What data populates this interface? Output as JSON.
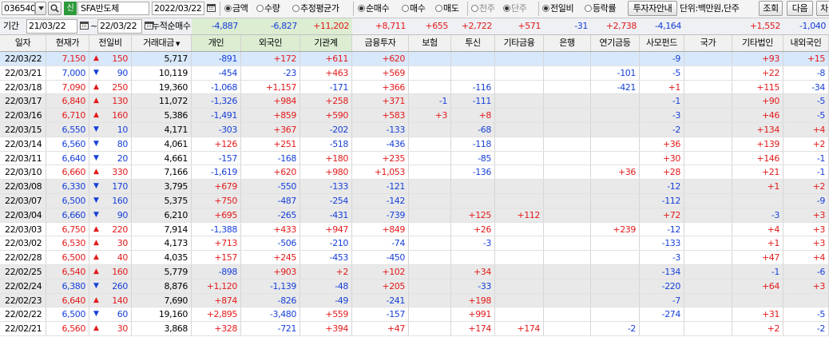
{
  "toolbar": {
    "code": "036540",
    "search_icon": "magnifier-icon",
    "badge": "신",
    "name": "SFA반도체",
    "date": "2022/03/22",
    "radio_group1": [
      {
        "label": "금액",
        "checked": true,
        "dim": false
      },
      {
        "label": "수량",
        "checked": false,
        "dim": false
      },
      {
        "label": "추정평균가",
        "checked": false,
        "dim": false
      }
    ],
    "radio_group2": [
      {
        "label": "순매수",
        "checked": true,
        "dim": false
      },
      {
        "label": "매수",
        "checked": false,
        "dim": false
      },
      {
        "label": "매도",
        "checked": false,
        "dim": false
      }
    ],
    "radio_group3": [
      {
        "label": "천주",
        "checked": false,
        "dim": true
      },
      {
        "label": "단주",
        "checked": true,
        "dim": true
      }
    ],
    "radio_group4": [
      {
        "label": "전일비",
        "checked": true,
        "dim": false
      },
      {
        "label": "등락률",
        "checked": false,
        "dim": false
      }
    ],
    "guide_button": "투자자안내",
    "unit_label": "단위:백만원,단주",
    "search_button": "조회",
    "next_button": "다음",
    "chart_button": "차"
  },
  "period": {
    "label": "기간",
    "from": "21/03/22",
    "tilde": "~",
    "to": "22/03/22",
    "cum_label": "누적순매수",
    "cum_values": [
      "-4,887",
      "-6,827",
      "+11,202",
      "+8,711",
      "+655",
      "+2,722",
      "+571",
      "-31",
      "+2,738",
      "-4,164",
      "",
      "+1,552",
      "-1,040"
    ]
  },
  "columns": [
    "일자",
    "현재가",
    "전일비",
    "거래대금",
    "개인",
    "외국인",
    "기관계",
    "금융투자",
    "보험",
    "투신",
    "기타금융",
    "은행",
    "연기금등",
    "사모펀드",
    "국가",
    "기타법인",
    "내외국인"
  ],
  "rows": [
    {
      "date": "22/03/22",
      "price": "7,150",
      "dir": "up",
      "chg": "150",
      "vol": "5,717",
      "vals": [
        "-891",
        "+172",
        "+611",
        "+620",
        "",
        "",
        "",
        "",
        "",
        "-9",
        "",
        "+93",
        "+15"
      ]
    },
    {
      "date": "22/03/21",
      "price": "7,000",
      "dir": "down",
      "chg": "90",
      "vol": "10,119",
      "vals": [
        "-454",
        "-23",
        "+463",
        "+569",
        "",
        "",
        "",
        "",
        "-101",
        "-5",
        "",
        "+22",
        "-8"
      ]
    },
    {
      "date": "22/03/18",
      "price": "7,090",
      "dir": "up",
      "chg": "250",
      "vol": "19,360",
      "vals": [
        "-1,068",
        "+1,157",
        "-171",
        "+366",
        "",
        "-116",
        "",
        "",
        "-421",
        "+1",
        "",
        "+115",
        "-34"
      ]
    },
    {
      "date": "22/03/17",
      "price": "6,840",
      "dir": "up",
      "chg": "130",
      "vol": "11,072",
      "vals": [
        "-1,326",
        "+984",
        "+258",
        "+371",
        "-1",
        "-111",
        "",
        "",
        "",
        "-1",
        "",
        "+90",
        "-5"
      ]
    },
    {
      "date": "22/03/16",
      "price": "6,710",
      "dir": "up",
      "chg": "160",
      "vol": "5,386",
      "vals": [
        "-1,491",
        "+859",
        "+590",
        "+583",
        "+3",
        "+8",
        "",
        "",
        "",
        "-3",
        "",
        "+46",
        "-5"
      ]
    },
    {
      "date": "22/03/15",
      "price": "6,550",
      "dir": "down",
      "chg": "10",
      "vol": "4,171",
      "vals": [
        "-303",
        "+367",
        "-202",
        "-133",
        "",
        "-68",
        "",
        "",
        "",
        "-2",
        "",
        "+134",
        "+4"
      ]
    },
    {
      "date": "22/03/14",
      "price": "6,560",
      "dir": "down",
      "chg": "80",
      "vol": "4,061",
      "vals": [
        "+126",
        "+251",
        "-518",
        "-436",
        "",
        "-118",
        "",
        "",
        "",
        "+36",
        "",
        "+139",
        "+2"
      ]
    },
    {
      "date": "22/03/11",
      "price": "6,640",
      "dir": "down",
      "chg": "20",
      "vol": "4,661",
      "vals": [
        "-157",
        "-168",
        "+180",
        "+235",
        "",
        "-85",
        "",
        "",
        "",
        "+30",
        "",
        "+146",
        "-1"
      ]
    },
    {
      "date": "22/03/10",
      "price": "6,660",
      "dir": "up",
      "chg": "330",
      "vol": "7,166",
      "vals": [
        "-1,619",
        "+620",
        "+980",
        "+1,053",
        "",
        "-136",
        "",
        "",
        "+36",
        "+28",
        "",
        "+21",
        "-1"
      ]
    },
    {
      "date": "22/03/08",
      "price": "6,330",
      "dir": "down",
      "chg": "170",
      "vol": "3,795",
      "vals": [
        "+679",
        "-550",
        "-133",
        "-121",
        "",
        "",
        "",
        "",
        "",
        "-12",
        "",
        "+1",
        "+2"
      ]
    },
    {
      "date": "22/03/07",
      "price": "6,500",
      "dir": "down",
      "chg": "160",
      "vol": "5,375",
      "vals": [
        "+750",
        "-487",
        "-254",
        "-142",
        "",
        "",
        "",
        "",
        "",
        "-112",
        "",
        "",
        "-9"
      ]
    },
    {
      "date": "22/03/04",
      "price": "6,660",
      "dir": "down",
      "chg": "90",
      "vol": "6,210",
      "vals": [
        "+695",
        "-265",
        "-431",
        "-739",
        "",
        "+125",
        "+112",
        "",
        "",
        "+72",
        "",
        "-3",
        "+3"
      ]
    },
    {
      "date": "22/03/03",
      "price": "6,750",
      "dir": "up",
      "chg": "220",
      "vol": "7,914",
      "vals": [
        "-1,388",
        "+433",
        "+947",
        "+849",
        "",
        "+26",
        "",
        "",
        "+239",
        "-12",
        "",
        "+4",
        "+3"
      ]
    },
    {
      "date": "22/03/02",
      "price": "6,530",
      "dir": "up",
      "chg": "30",
      "vol": "4,173",
      "vals": [
        "+713",
        "-506",
        "-210",
        "-74",
        "",
        "-3",
        "",
        "",
        "",
        "-133",
        "",
        "+1",
        "+3"
      ]
    },
    {
      "date": "22/02/28",
      "price": "6,500",
      "dir": "up",
      "chg": "40",
      "vol": "4,035",
      "vals": [
        "+157",
        "+245",
        "-453",
        "-450",
        "",
        "",
        "",
        "",
        "",
        "-3",
        "",
        "+47",
        "+4"
      ]
    },
    {
      "date": "22/02/25",
      "price": "6,540",
      "dir": "up",
      "chg": "160",
      "vol": "5,779",
      "vals": [
        "-898",
        "+903",
        "+2",
        "+102",
        "",
        "+34",
        "",
        "",
        "",
        "-134",
        "",
        "-1",
        "-6"
      ]
    },
    {
      "date": "22/02/24",
      "price": "6,380",
      "dir": "down",
      "chg": "260",
      "vol": "8,876",
      "vals": [
        "+1,120",
        "-1,139",
        "-48",
        "+205",
        "",
        "-33",
        "",
        "",
        "",
        "-220",
        "",
        "+64",
        "+3"
      ]
    },
    {
      "date": "22/02/23",
      "price": "6,640",
      "dir": "up",
      "chg": "140",
      "vol": "7,690",
      "vals": [
        "+874",
        "-826",
        "-49",
        "-241",
        "",
        "+198",
        "",
        "",
        "",
        "-7",
        "",
        "",
        ""
      ]
    },
    {
      "date": "22/02/22",
      "price": "6,500",
      "dir": "down",
      "chg": "60",
      "vol": "19,160",
      "vals": [
        "+2,895",
        "-3,480",
        "+559",
        "-157",
        "",
        "+991",
        "",
        "",
        "",
        "-274",
        "",
        "+31",
        "-5"
      ]
    },
    {
      "date": "22/02/21",
      "price": "6,560",
      "dir": "up",
      "chg": "30",
      "vol": "3,868",
      "vals": [
        "+328",
        "-721",
        "+394",
        "+47",
        "",
        "+174",
        "+174",
        "",
        "-2",
        "",
        "",
        "+2",
        "-2"
      ]
    }
  ],
  "colors": {
    "up": "#e31a1a",
    "down": "#1740d8",
    "highlight_header": "#dcedd2",
    "selected_row": "#d8e8fb"
  }
}
